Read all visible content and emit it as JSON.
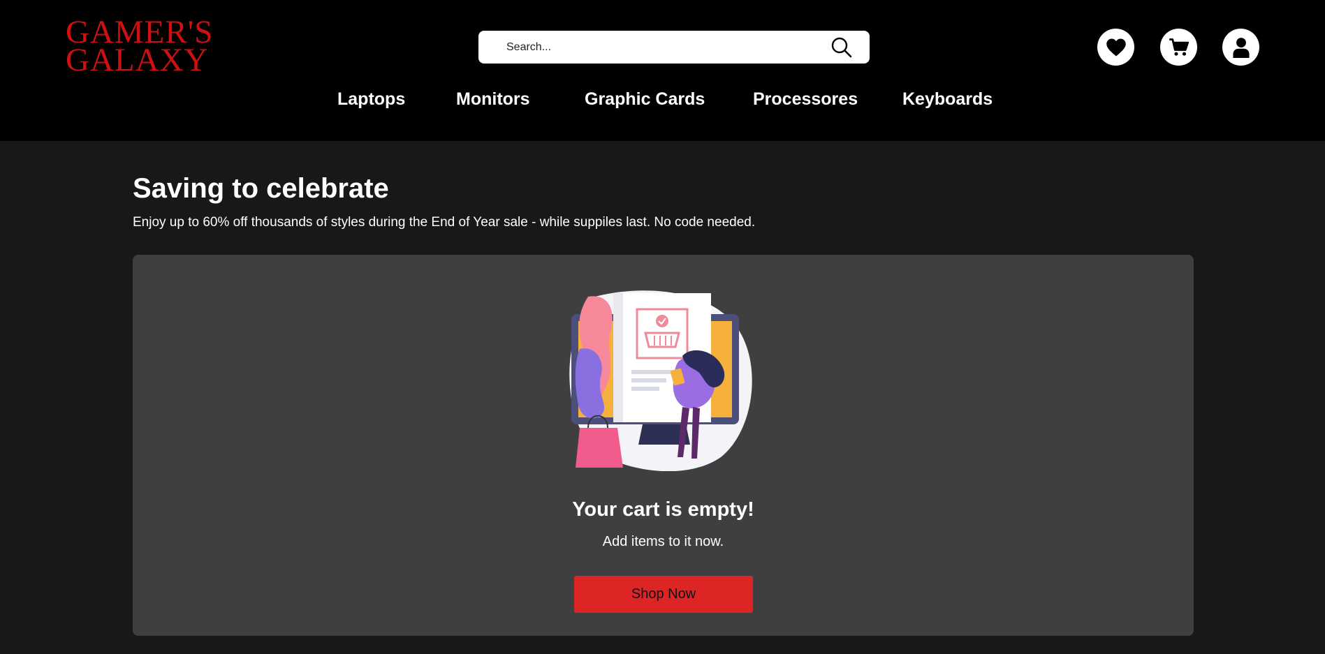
{
  "brand": {
    "line1": "GAMER'S",
    "line2": "GALAXY",
    "color": "#d01010"
  },
  "search": {
    "placeholder": "Search...",
    "icon": "search-icon"
  },
  "header_actions": [
    {
      "name": "wishlist",
      "icon": "heart-icon"
    },
    {
      "name": "cart",
      "icon": "cart-icon"
    },
    {
      "name": "account",
      "icon": "user-icon"
    }
  ],
  "nav": {
    "items": [
      {
        "label": "Laptops"
      },
      {
        "label": "Monitors"
      },
      {
        "label": "Graphic Cards"
      },
      {
        "label": "Processores"
      },
      {
        "label": "Keyboards"
      }
    ]
  },
  "promo": {
    "title": "Saving to celebrate",
    "subtitle": "Enjoy up to 60% off thousands of styles during the End of Year sale - while suppiles last. No code needed."
  },
  "cart": {
    "empty_title": "Your cart is empty!",
    "empty_subtitle": "Add items to it now.",
    "shop_button": "Shop Now",
    "illustration": "online-shopping-illustration"
  },
  "colors": {
    "header_bg": "#000000",
    "page_bg": "#181818",
    "panel_bg": "#3f3f3f",
    "accent": "#de2525"
  }
}
